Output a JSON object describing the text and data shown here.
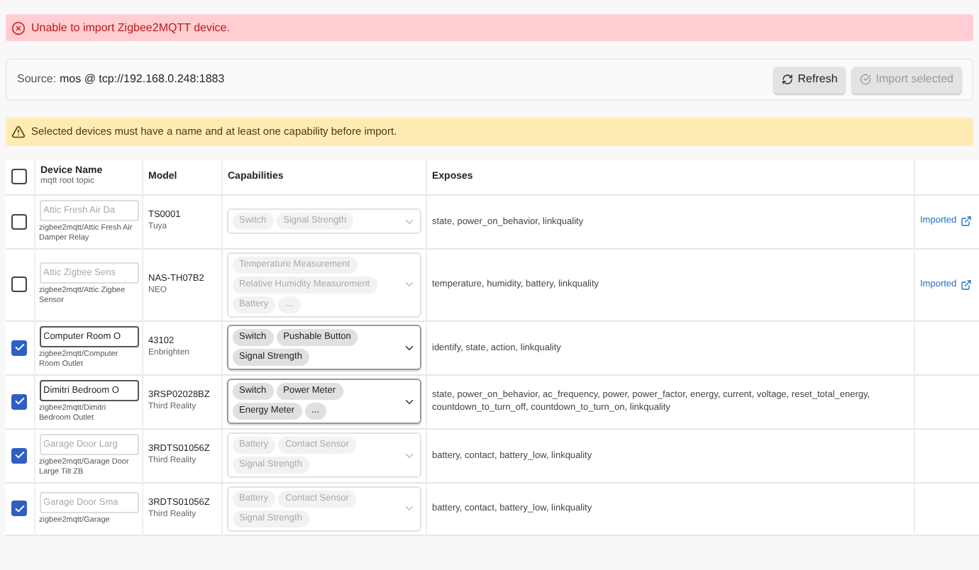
{
  "error_banner": {
    "text": "Unable to import Zigbee2MQTT device."
  },
  "source": {
    "label": "Source:",
    "value": "mos @ tcp://192.168.0.248:1883",
    "buttons": [
      {
        "label": "Refresh",
        "kind": "refresh",
        "disabled": false
      },
      {
        "label": "Import selected",
        "kind": "import",
        "disabled": true
      }
    ]
  },
  "warning_banner": {
    "text": "Selected devices must have a name and at least one capability before import."
  },
  "table": {
    "select_all": {
      "checked": false
    },
    "columns": [
      {
        "label": "Device Name",
        "sublabel": "mqtt root topic"
      },
      {
        "label": "Model"
      },
      {
        "label": "Capabilities"
      },
      {
        "label": "Exposes"
      }
    ],
    "rows": [
      {
        "checked": false,
        "name": {
          "placeholder": "Attic Fresh Air Da"
        },
        "topic": "zigbee2mqtt/Attic Fresh Air Damper Relay",
        "model": "TS0001",
        "manufacturer": "Tuya",
        "capabilities_disabled": true,
        "capabilities": [
          "Switch",
          "Signal Strength"
        ],
        "exposes": "state, power_on_behavior, linkquality",
        "status": "Imported"
      },
      {
        "checked": false,
        "name": {
          "placeholder": "Attic Zigbee Sens"
        },
        "topic": "zigbee2mqtt/Attic Zigbee Sensor",
        "model": "NAS-TH07B2",
        "manufacturer": "NEO",
        "capabilities_disabled": true,
        "capabilities": [
          "Temperature Measurement",
          "Relative Humidity Measurement",
          "Battery",
          "..."
        ],
        "exposes": "temperature, humidity, battery, linkquality",
        "status": "Imported"
      },
      {
        "checked": true,
        "name": {
          "value": "Computer Room O"
        },
        "topic": "zigbee2mqtt/Computer Room Outlet",
        "model": "43102",
        "manufacturer": "Enbrighten",
        "capabilities_disabled": false,
        "capabilities": [
          "Switch",
          "Pushable Button",
          "Signal Strength"
        ],
        "exposes": "identify, state, action, linkquality"
      },
      {
        "checked": true,
        "name": {
          "value": "Dimitri Bedroom O"
        },
        "topic": "zigbee2mqtt/Dimitri Bedroom Outlet",
        "model": "3RSP02028BZ",
        "manufacturer": "Third Reality",
        "capabilities_disabled": false,
        "capabilities": [
          "Switch",
          "Power Meter",
          "Energy Meter",
          "..."
        ],
        "exposes": "state, power_on_behavior, ac_frequency, power, power_factor, energy, current, voltage, reset_total_energy, countdown_to_turn_off, countdown_to_turn_on, linkquality"
      },
      {
        "checked": true,
        "name": {
          "placeholder": "Garage Door Larg"
        },
        "topic": "zigbee2mqtt/Garage Door Large Tilt ZB",
        "model": "3RDTS01056Z",
        "manufacturer": "Third Reality",
        "capabilities_disabled": true,
        "capabilities": [
          "Battery",
          "Contact Sensor",
          "Signal Strength"
        ],
        "exposes": "battery, contact, battery_low, linkquality"
      },
      {
        "checked": true,
        "name": {
          "placeholder": "Garage Door Sma"
        },
        "topic": "zigbee2mqtt/Garage",
        "model": "3RDTS01056Z",
        "manufacturer": "Third Reality",
        "capabilities_disabled": true,
        "capabilities": [
          "Battery",
          "Contact Sensor",
          "Signal Strength"
        ],
        "exposes": "battery, contact, battery_low, linkquality"
      }
    ]
  }
}
